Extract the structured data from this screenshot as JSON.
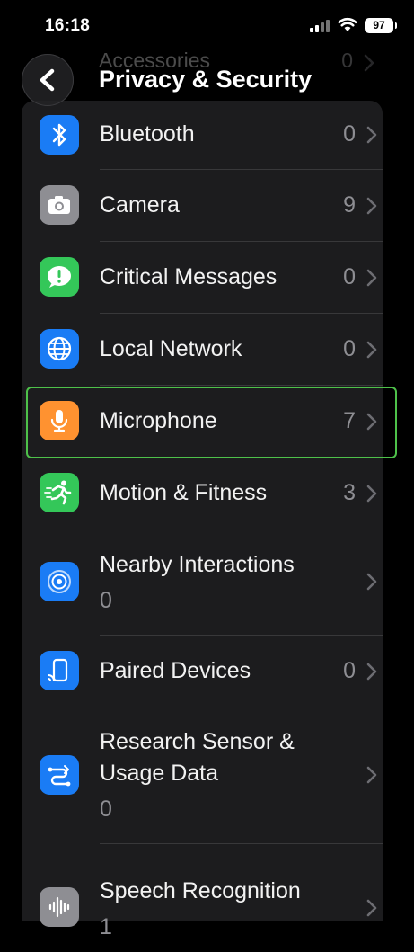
{
  "status_bar": {
    "time": "16:18",
    "battery": "97"
  },
  "header": {
    "title": "Privacy & Security",
    "peek_row": {
      "label": "Accessories",
      "count": "0"
    }
  },
  "colors": {
    "highlight": "#4ec14a",
    "background": "#000000",
    "list_bg": "#1c1c1e"
  },
  "rows": [
    {
      "label": "Bluetooth",
      "count": "0",
      "icon": "bluetooth-icon",
      "color": "#1a7cf5"
    },
    {
      "label": "Camera",
      "count": "9",
      "icon": "camera-icon",
      "color": "#8e8e93"
    },
    {
      "label": "Critical Messages",
      "count": "0",
      "icon": "critical-messages-icon",
      "color": "#34c759"
    },
    {
      "label": "Local Network",
      "count": "0",
      "icon": "globe-icon",
      "color": "#1a7cf5"
    },
    {
      "label": "Microphone",
      "count": "7",
      "icon": "microphone-icon",
      "color": "#ff9230",
      "highlighted": true
    },
    {
      "label": "Motion & Fitness",
      "count": "3",
      "icon": "running-figure-icon",
      "color": "#34c759"
    },
    {
      "label": "Nearby Interactions",
      "sub": "0",
      "icon": "nearby-interactions-icon",
      "color": "#1a7cf5"
    },
    {
      "label": "Paired Devices",
      "count": "0",
      "icon": "paired-devices-icon",
      "color": "#1a7cf5"
    },
    {
      "label_line1": "Research Sensor &",
      "label_line2": "Usage Data",
      "sub": "0",
      "icon": "research-sensor-icon",
      "color": "#1a7cf5"
    },
    {
      "label": "Speech Recognition",
      "sub": "1",
      "icon": "waveform-icon",
      "color": "#8e8e93"
    }
  ]
}
